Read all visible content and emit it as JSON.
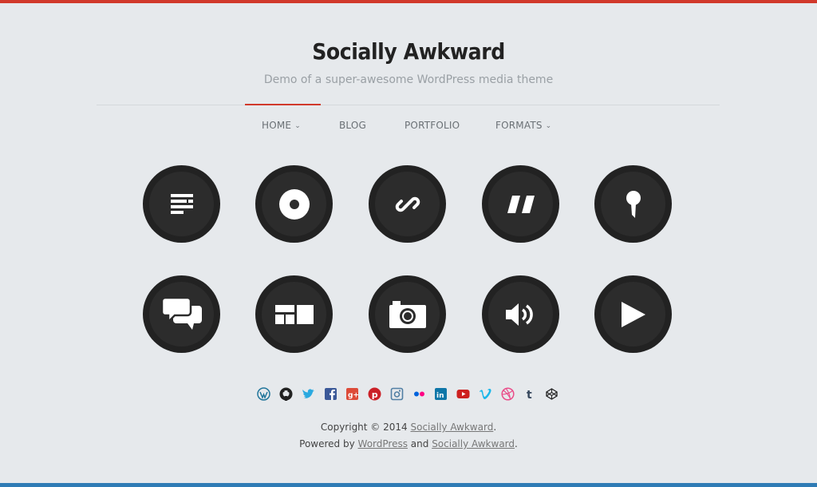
{
  "site": {
    "title": "Socially Awkward",
    "tagline": "Demo of a super-awesome WordPress media theme"
  },
  "nav": {
    "items": [
      {
        "label": "HOME",
        "has_dropdown": true,
        "active": true
      },
      {
        "label": "BLOG",
        "has_dropdown": false
      },
      {
        "label": "PORTFOLIO",
        "has_dropdown": false
      },
      {
        "label": "FORMATS",
        "has_dropdown": true
      }
    ]
  },
  "formats": [
    {
      "icon": "standard-text-icon"
    },
    {
      "icon": "audio-disc-icon"
    },
    {
      "icon": "link-icon"
    },
    {
      "icon": "quote-icon"
    },
    {
      "icon": "status-pin-icon"
    },
    {
      "icon": "chat-bubbles-icon"
    },
    {
      "icon": "gallery-icon"
    },
    {
      "icon": "camera-image-icon"
    },
    {
      "icon": "volume-audio-icon"
    },
    {
      "icon": "play-video-icon"
    }
  ],
  "social": [
    {
      "icon": "wordpress-icon",
      "color": "#21759b"
    },
    {
      "icon": "github-icon",
      "color": "#222222"
    },
    {
      "icon": "twitter-icon",
      "color": "#2aa9e0"
    },
    {
      "icon": "facebook-icon",
      "color": "#3b5998"
    },
    {
      "icon": "google-plus-icon",
      "color": "#dd4b39"
    },
    {
      "icon": "pinterest-icon",
      "color": "#cb2027"
    },
    {
      "icon": "instagram-icon",
      "color": "#517fa4"
    },
    {
      "icon": "flickr-icon",
      "color": "#ff0084"
    },
    {
      "icon": "linkedin-icon",
      "color": "#0e76a8"
    },
    {
      "icon": "youtube-icon",
      "color": "#cd201f"
    },
    {
      "icon": "vimeo-icon",
      "color": "#1ab7ea"
    },
    {
      "icon": "dribbble-icon",
      "color": "#ea4c89"
    },
    {
      "icon": "tumblr-icon",
      "color": "#35465c"
    },
    {
      "icon": "codepen-icon",
      "color": "#222222"
    }
  ],
  "footer": {
    "copyright_prefix": "Copyright © 2014 ",
    "copyright_link": "Socially Awkward",
    "copyright_suffix": ".",
    "powered_prefix": "Powered by ",
    "powered_link1": "WordPress",
    "powered_and": " and ",
    "powered_link2": "Socially Awkward",
    "powered_suffix": "."
  },
  "colors": {
    "accent_top": "#d1392b",
    "accent_bottom": "#2f7bb5",
    "background": "#e6e9ec",
    "circle": "#222222"
  }
}
